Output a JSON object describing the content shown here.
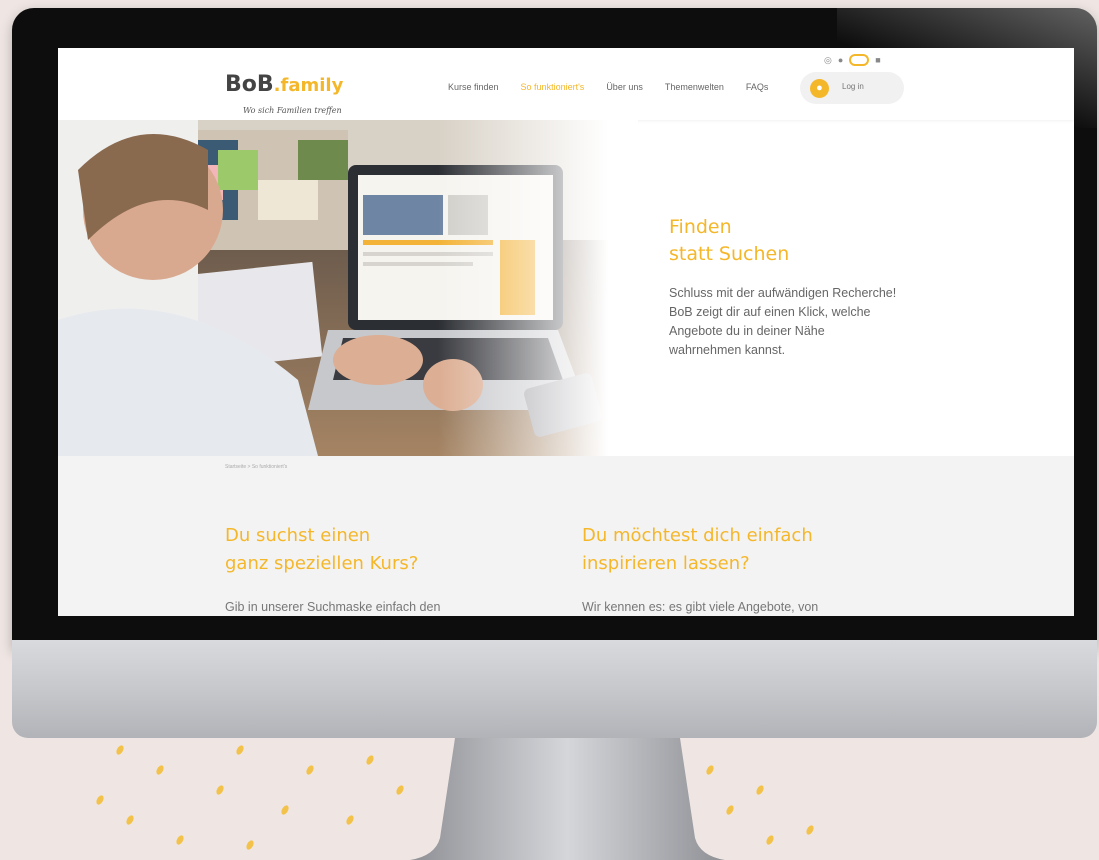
{
  "header": {
    "logo": {
      "main": "BoB",
      "suffix": ".family",
      "tagline": "Wo sich Familien treffen"
    },
    "nav": [
      {
        "label": "Kurse finden",
        "active": false
      },
      {
        "label": "So funktioniert's",
        "active": true
      },
      {
        "label": "Über uns",
        "active": false
      },
      {
        "label": "Themenwelten",
        "active": false
      },
      {
        "label": "FAQs",
        "active": false
      }
    ],
    "login_label": "Log in"
  },
  "hero": {
    "title_line1": "Finden",
    "title_line2": "statt Suchen",
    "text": "Schluss mit der aufwändigen Recherche! BoB zeigt dir auf einen Klick, welche Angebote du in deiner Nähe wahrnehmen kannst."
  },
  "breadcrumb": "Startseite > So funktioniert's",
  "columns": [
    {
      "title_line1": "Du suchst einen",
      "title_line2": "ganz speziellen Kurs?",
      "text": "Gib in unserer Suchmaske einfach den"
    },
    {
      "title_line1": "Du möchtest dich einfach",
      "title_line2": "inspirieren lassen?",
      "text": "Wir kennen es: es gibt viele Angebote, von"
    }
  ],
  "colors": {
    "accent": "#f5b72a",
    "background": "#efe6e3",
    "bezel": "#0d0d0e"
  }
}
